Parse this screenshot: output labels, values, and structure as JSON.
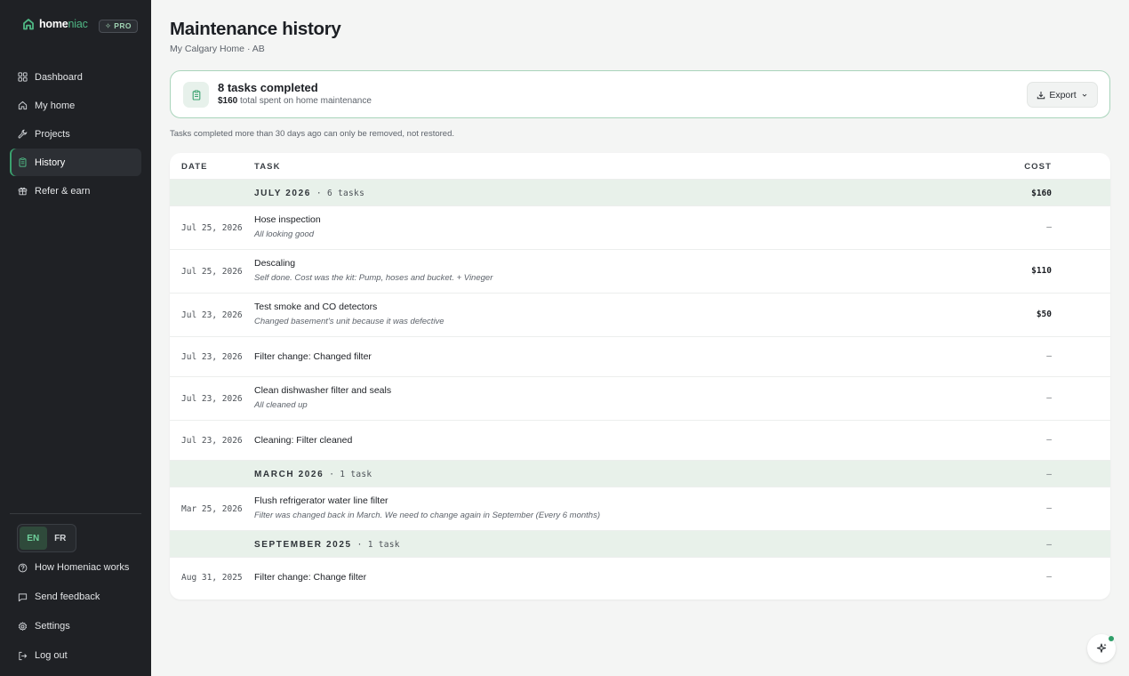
{
  "brand": {
    "name_primary": "home",
    "name_accent": "niac",
    "badge": "✧ PRO"
  },
  "sidebar": {
    "items": [
      {
        "label": "Dashboard",
        "icon": "grid-icon"
      },
      {
        "label": "My home",
        "icon": "house-icon"
      },
      {
        "label": "Projects",
        "icon": "wrench-icon"
      },
      {
        "label": "History",
        "icon": "clipboard-icon",
        "active": true
      },
      {
        "label": "Refer & earn",
        "icon": "gift-icon"
      }
    ],
    "languages": [
      "EN",
      "FR"
    ],
    "active_language": "EN",
    "bottom_items": [
      {
        "label": "How Homeniac works",
        "icon": "help-circle-icon"
      },
      {
        "label": "Send feedback",
        "icon": "message-icon"
      },
      {
        "label": "Settings",
        "icon": "gear-icon"
      },
      {
        "label": "Log out",
        "icon": "logout-icon"
      }
    ]
  },
  "page": {
    "title": "Maintenance history",
    "subtitle": "My Calgary Home · AB"
  },
  "summary": {
    "title": "8 tasks completed",
    "amount": "$160",
    "amount_suffix": " total spent on home maintenance",
    "export_label": "Export"
  },
  "note": "Tasks completed more than 30 days ago can only be removed, not restored.",
  "table": {
    "headers": {
      "date": "DATE",
      "task": "TASK",
      "cost": "COST"
    },
    "groups": [
      {
        "label": "JULY 2026",
        "count": " · 6 tasks",
        "cost": "$160",
        "rows": [
          {
            "date": "Jul 25, 2026",
            "task": "Hose inspection",
            "note": "All looking good",
            "cost": "—"
          },
          {
            "date": "Jul 25, 2026",
            "task": "Descaling",
            "note": "Self done. Cost was the kit: Pump, hoses and bucket. + Vineger",
            "cost": "$110"
          },
          {
            "date": "Jul 23, 2026",
            "task": "Test smoke and CO detectors",
            "note": "Changed basement's unit because it was defective",
            "cost": "$50"
          },
          {
            "date": "Jul 23, 2026",
            "task": "Filter change: Changed filter",
            "note": "",
            "cost": "—"
          },
          {
            "date": "Jul 23, 2026",
            "task": "Clean dishwasher filter and seals",
            "note": "All cleaned up",
            "cost": "—"
          },
          {
            "date": "Jul 23, 2026",
            "task": "Cleaning: Filter cleaned",
            "note": "",
            "cost": "—"
          }
        ]
      },
      {
        "label": "MARCH 2026",
        "count": " · 1 task",
        "cost": "—",
        "rows": [
          {
            "date": "Mar 25, 2026",
            "task": "Flush refrigerator water line filter",
            "note": "Filter was changed back in March. We need to change again in September (Every 6 months)",
            "cost": "—"
          }
        ]
      },
      {
        "label": "SEPTEMBER 2025",
        "count": " · 1 task",
        "cost": "—",
        "rows": [
          {
            "date": "Aug 31, 2025",
            "task": "Filter change: Change filter",
            "note": "",
            "cost": "—"
          }
        ]
      }
    ]
  },
  "colors": {
    "accent": "#3aa26f",
    "sidebar_bg": "#1f2125",
    "group_bg": "#e8f1ea",
    "card_border": "#a9d4bb"
  }
}
